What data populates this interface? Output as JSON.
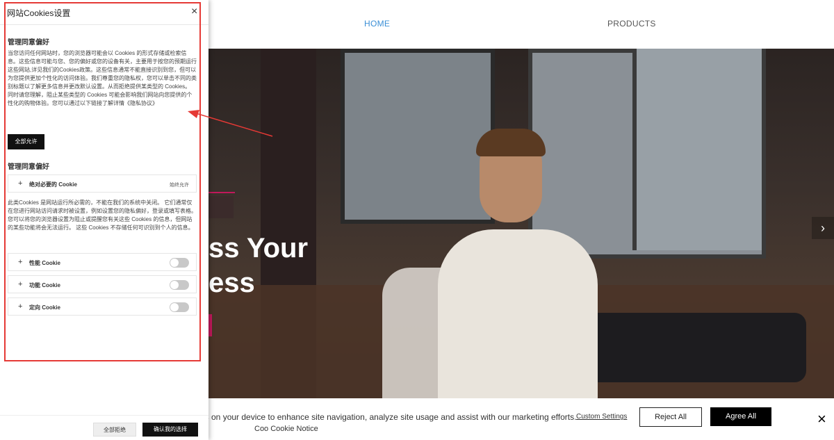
{
  "nav": {
    "home": "HOME",
    "products": "PRODUCTS"
  },
  "hero": {
    "title_line1": "ss Your",
    "title_line2": "ess",
    "next_icon": "chevron-right-icon"
  },
  "notice": {
    "text": "es on your device to enhance site navigation, analyze site usage and assist with our marketing efforts.",
    "title": "Coo Cookie Notice",
    "custom_settings": "Custom Settings",
    "reject_all": "Reject All",
    "accept_all": "Agree All",
    "close_icon": "×"
  },
  "panel": {
    "title": "网站Cookies设置",
    "close": "×",
    "heading1": "管理同意偏好",
    "intro": "当您访问任何网站时，您的浏览器可能会以 Cookies 的形式存储或检索信息。这些信息可能与您、您的偏好或您的设备有关，主要用于按您的预期运行这些网站,详见我们的Cookies政策。这些信息通常不能直接识别到您，但可以为您提供更加个性化的访问体验。我们尊重您的隐私权，您可以单击不同的类别标题以了解更多信息并更改默认设置。从而拒绝提供某类型的 Cookies。 同时请您理解，阻止某些类型的 Cookies 可能会影响我们网站向您提供的个性化的购物体验。您可以通过以下链接了解详情《隐私协议》",
    "allow_all": "全部允许",
    "heading2": "管理同意偏好",
    "strict": {
      "label": "绝对必要的 Cookie",
      "status": "始终允许"
    },
    "strict_desc": "此类Cookies 是网站运行所必需的，不能在我们的系统中关闭。 它们通常仅在您进行网站访问请求时被设置，例如设置您的隐私偏好，登录或填写表格。 您可以将您的浏览器设置为阻止或提醒您有关这些 Cookies 的信息，但网站的某些功能将会无法运行。 这些 Cookies 不存储任何可识别到个人的信息。",
    "performance": {
      "label": "性能 Cookie",
      "enabled": false
    },
    "functional": {
      "label": "功能 Cookie",
      "enabled": false
    },
    "targeting": {
      "label": "定向 Cookie",
      "enabled": false
    },
    "reject_all": "全部拒绝",
    "confirm": "确认我的选择"
  },
  "colors": {
    "accent_blue": "#3b8fd6",
    "highlight_red": "#e53935",
    "brand_magenta": "#c2185b"
  }
}
